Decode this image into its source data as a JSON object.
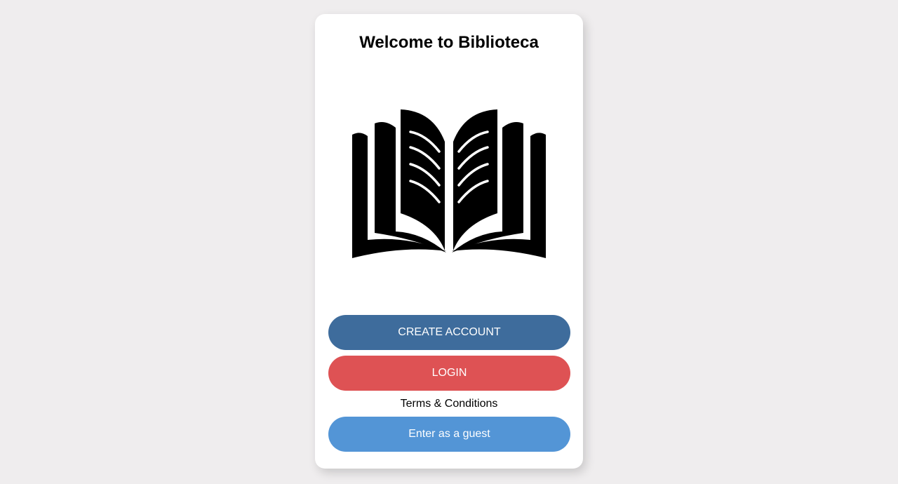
{
  "card": {
    "title": "Welcome to Biblioteca",
    "logo_icon": "open-book-icon"
  },
  "actions": {
    "create_account_label": "CREATE ACCOUNT",
    "login_label": "LOGIN",
    "terms_label": "Terms & Conditions",
    "guest_label": "Enter as a guest"
  },
  "colors": {
    "background": "#efedee",
    "card": "#ffffff",
    "create_account": "#3e6c9c",
    "login": "#de5254",
    "guest": "#5395d6"
  }
}
